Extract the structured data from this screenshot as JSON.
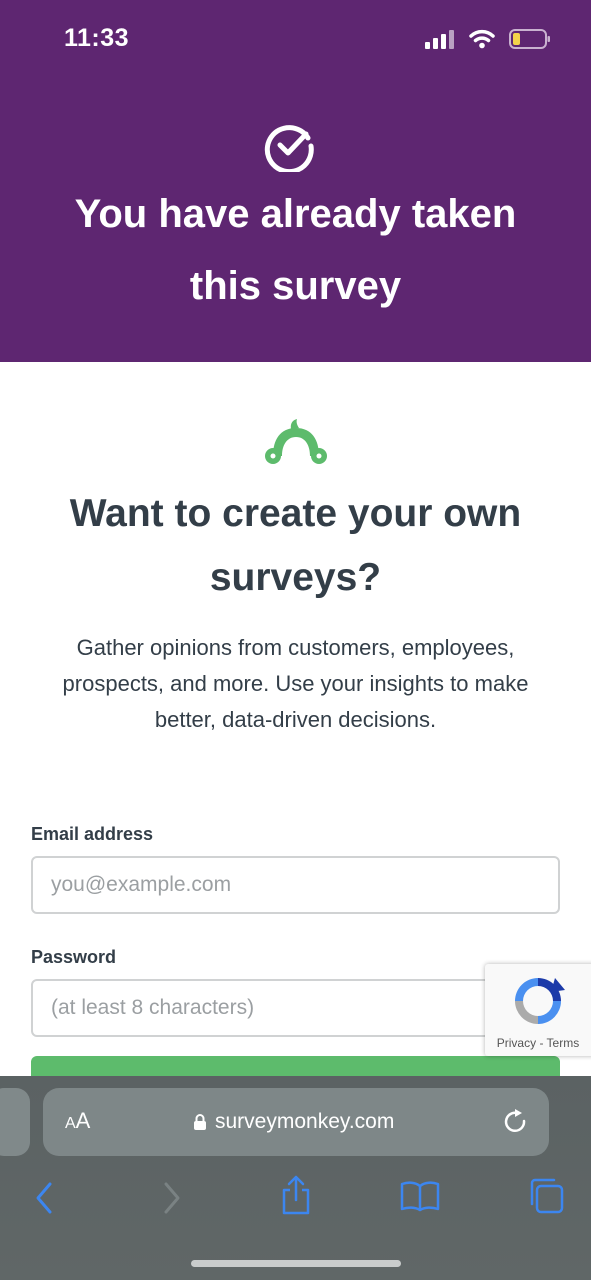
{
  "status_bar": {
    "time": "11:33"
  },
  "hero": {
    "title_line1": "You have already taken",
    "title_line2": "this survey",
    "background_color": "#5e2671"
  },
  "promo": {
    "logo": "surveymonkey-logo-icon",
    "title_line1": "Want to create your own",
    "title_line2": "surveys?",
    "text_line1": "Gather opinions from customers, employees,",
    "text_line2": "prospects, and more. Use your insights to make",
    "text_line3": "better, data-driven decisions."
  },
  "form": {
    "email_label": "Email address",
    "email_placeholder": "you@example.com",
    "password_label": "Password",
    "password_placeholder": "(at least 8 characters)",
    "button_color": "#5dbb6c"
  },
  "recaptcha": {
    "links": "Privacy - Terms"
  },
  "browser": {
    "aa_label_small": "A",
    "aa_label_large": "A",
    "url": "surveymonkey.com",
    "accent_color": "#3c86f0"
  }
}
